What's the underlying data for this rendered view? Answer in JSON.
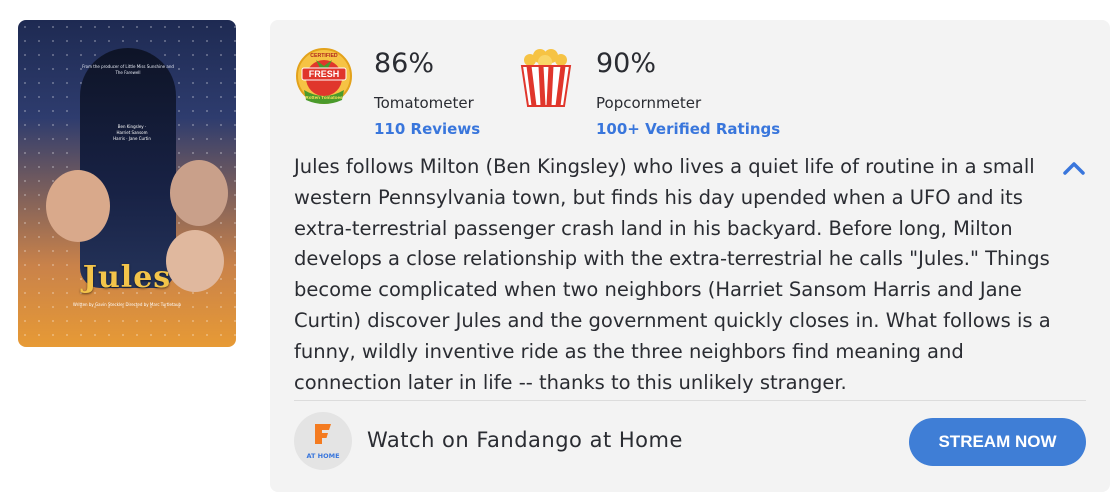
{
  "poster": {
    "title": "Jules",
    "tagline": "From the producer of Little Miss Sunshine and The Farewell",
    "cast": "Ben Kingsley · Harriet Sansom Harris · Jane Curtin",
    "byline": "Written by Gavin Steckler  Directed by Marc Turtletaub"
  },
  "tomatometer": {
    "badge_top": "CERTIFIED",
    "badge_main": "FRESH",
    "badge_bottom": "Rotten Tomatoes",
    "score": "86%",
    "label": "Tomatometer",
    "count": "110 Reviews"
  },
  "popcornmeter": {
    "score": "90%",
    "label": "Popcornmeter",
    "count": "100+ Verified Ratings"
  },
  "synopsis": "Jules follows Milton (Ben Kingsley) who lives a quiet life of routine in a small western Pennsylvania town, but finds his day upended when a UFO and its extra-terrestrial passenger crash land in his backyard. Before long, Milton develops a close relationship with the extra-terrestrial he calls \"Jules.\" Things become complicated when two neighbors (Harriet Sansom Harris and Jane Curtin) discover Jules and the government quickly closes in. What follows is a funny, wildly inventive ride as the three neighbors find meaning and connection later in life -- thanks to this unlikely stranger.",
  "streaming": {
    "logo_text": "AT HOME",
    "label": "Watch on Fandango at Home",
    "button": "STREAM NOW"
  },
  "colors": {
    "link": "#3976dc",
    "button": "#3f7ed6",
    "panel": "#f3f3f3",
    "tomato_red": "#e0362c",
    "tomato_gold": "#f6c344"
  },
  "icons": {
    "tomatometer": "certified-fresh-icon",
    "popcornmeter": "popcorn-bucket-icon",
    "collapse": "chevron-up-icon",
    "fandango": "fandango-f-icon"
  }
}
